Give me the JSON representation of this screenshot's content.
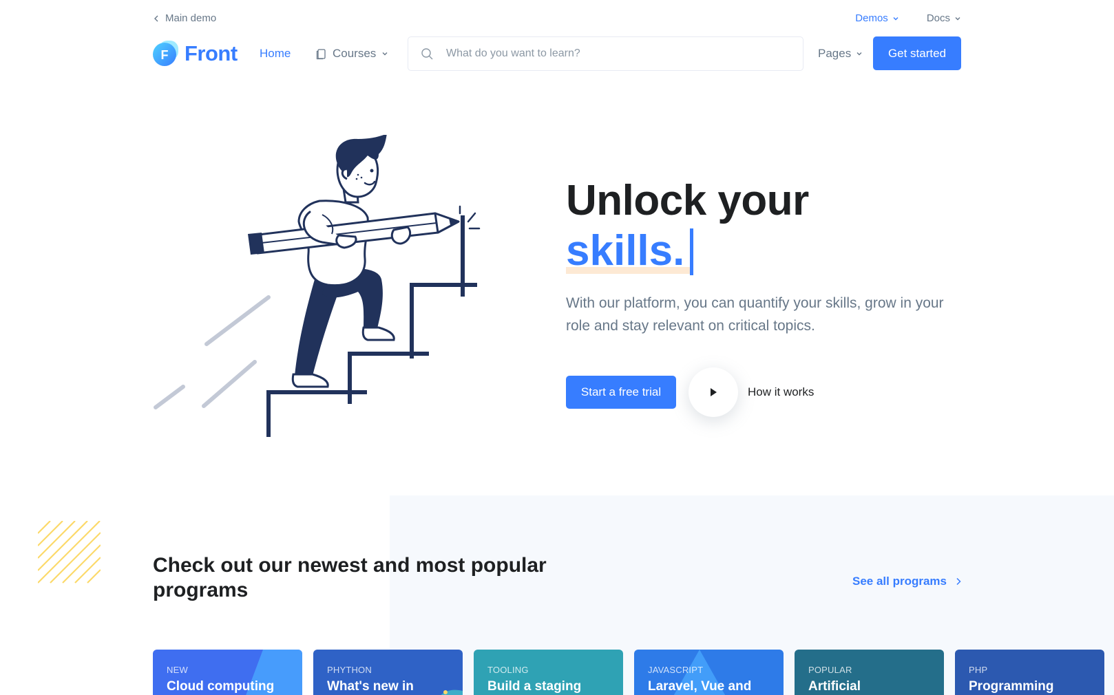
{
  "topbar": {
    "back_label": "Main demo",
    "demos_label": "Demos",
    "docs_label": "Docs"
  },
  "navbar": {
    "logo_letter": "F",
    "logo_text": "Front",
    "home_label": "Home",
    "courses_label": "Courses",
    "search_placeholder": "What do you want to learn?",
    "pages_label": "Pages",
    "cta_label": "Get started"
  },
  "hero": {
    "title_line1": "Unlock your",
    "title_line2": "skills.",
    "lead": "With our platform, you can quantify your skills, grow in your role and stay relevant on critical topics.",
    "primary_button": "Start a free trial",
    "secondary_label": "How it works"
  },
  "programs": {
    "title": "Check out our newest and most popular programs",
    "see_all_label": "See all programs",
    "cards": [
      {
        "tag": "NEW",
        "title": "Cloud computing",
        "color": "#3f6ef0"
      },
      {
        "tag": "PHYTHON",
        "title": "What's new in",
        "color": "#2f62c6"
      },
      {
        "tag": "TOOLING",
        "title": "Build a staging",
        "color": "#2fa2b4"
      },
      {
        "tag": "JAVASCRIPT",
        "title": "Laravel, Vue and",
        "color": "#2e7be8"
      },
      {
        "tag": "POPULAR",
        "title": "Artificial",
        "color": "#246e8a"
      },
      {
        "tag": "PHP",
        "title": "Programming",
        "color": "#2c59b0"
      }
    ]
  },
  "colors": {
    "primary": "#377dff",
    "text_dark": "#1e2022",
    "text_muted": "#677788",
    "hero_underline": "#fde9d4",
    "section_bg": "#f6f9fd",
    "stripe_yellow": "#fcd969",
    "illustration_navy": "#21325b"
  },
  "icons": {
    "back": "chevron-left-icon",
    "dropdown": "chevron-down-icon",
    "courses": "book-icon",
    "search": "search-icon",
    "play": "play-icon",
    "see_all": "chevron-right-icon"
  }
}
